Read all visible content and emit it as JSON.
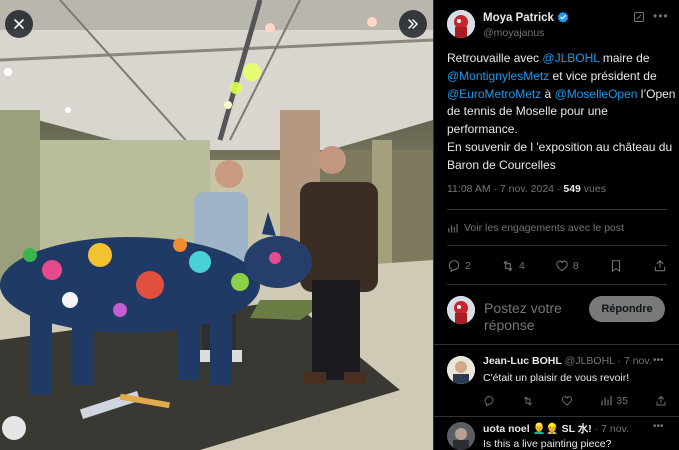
{
  "viewer": {
    "close_icon": "close-icon",
    "next_icon": "chevron-double-right-icon"
  },
  "tweet": {
    "author_name": "Moya Patrick",
    "author_handle": "@moyajanus",
    "verified_color": "#1d9bf0",
    "text": {
      "p1": "Retrouvaille avec ",
      "mention1": "@JLBOHL",
      "p2": " maire de ",
      "mention2": "@MontignylesMetz",
      "p3": " et vice président de ",
      "mention3": "@EuroMetroMetz",
      "p4": "  à ",
      "mention4": "@MoselleOpen",
      "p5": " l’Open de tennis de Moselle pour une performance.",
      "p6": "En souvenir de l 'exposition au château du Baron de Courcelles"
    },
    "time": "11:08 AM · 7 nov. 2024 · ",
    "views_count": "549",
    "views_label": " vues",
    "engagements_label": "Voir les engagements avec le post",
    "stats": {
      "replies": "2",
      "reposts": "4",
      "likes": "8"
    }
  },
  "composer": {
    "placeholder": "Postez votre réponse",
    "reply_button": "Répondre"
  },
  "replies": [
    {
      "name": "Jean-Luc BOHL",
      "handle_time": " @JLBOHL · 7 nov.",
      "text": "C'était un plaisir de vous revoir!",
      "views": "35"
    },
    {
      "name": "uota noel 👱‍♂️👷 SL 水!",
      "handle_time": " · 7 nov.",
      "text": "Is this a live painting piece?"
    }
  ],
  "colors": {
    "background": "#000000",
    "link": "#1d9bf0",
    "muted": "#71767b",
    "text": "#e7e9ea"
  }
}
